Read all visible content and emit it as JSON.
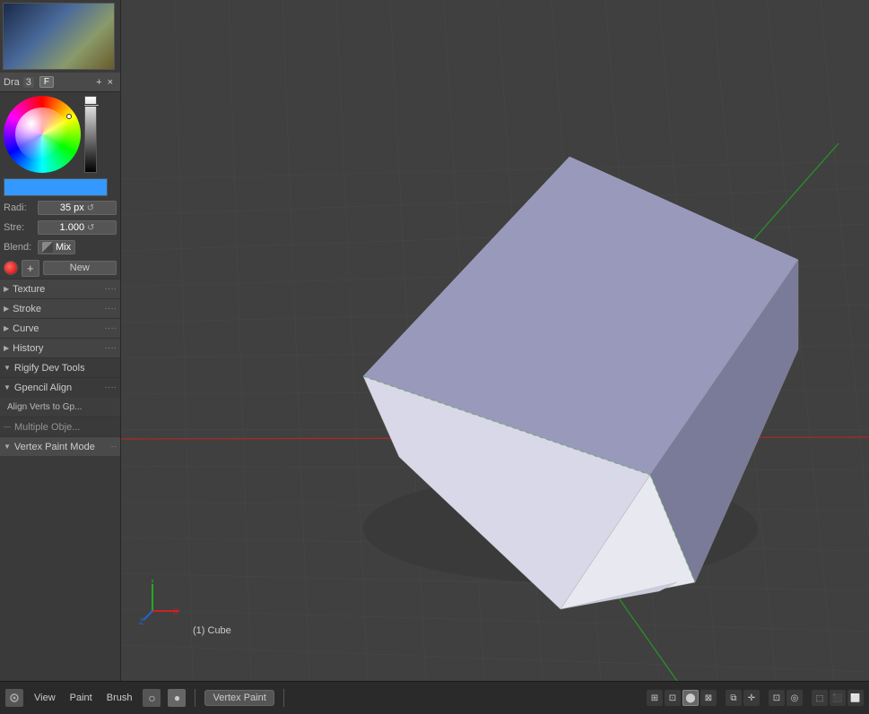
{
  "leftPanel": {
    "brushHeader": {
      "prefix": "Dra",
      "num": "3",
      "fLabel": "F",
      "plusLabel": "+",
      "xLabel": "×"
    },
    "radius": {
      "label": "Radi:",
      "value": "35 px"
    },
    "strength": {
      "label": "Stre:",
      "value": "1.000"
    },
    "blend": {
      "label": "Blend:",
      "value": "Mix"
    },
    "newSection": {
      "plusLabel": "+",
      "newLabel": "New"
    },
    "sections": [
      {
        "label": "Texture",
        "expanded": false
      },
      {
        "label": "Stroke",
        "expanded": false
      },
      {
        "label": "Curve",
        "expanded": false
      },
      {
        "label": "History",
        "expanded": false
      },
      {
        "label": "Rigify Dev Tools",
        "expanded": true
      }
    ],
    "gpencilSection": {
      "header": "Gpencil Align",
      "item": "Align Verts to Gp..."
    },
    "multipleObjects": {
      "label": "Multiple Obje..."
    },
    "vertexPaintMode": {
      "label": "Vertex Paint Mode"
    }
  },
  "viewport": {
    "objectName": "(1) Cube"
  },
  "bottomBar": {
    "menuItems": [
      "View",
      "Paint",
      "Brush",
      "Vertex Paint"
    ],
    "brushCircleLabel": "○",
    "brushDotLabel": "●",
    "modeButtons": [
      "⊞",
      "⊠",
      "⊟",
      "⊞",
      "⊠"
    ]
  }
}
